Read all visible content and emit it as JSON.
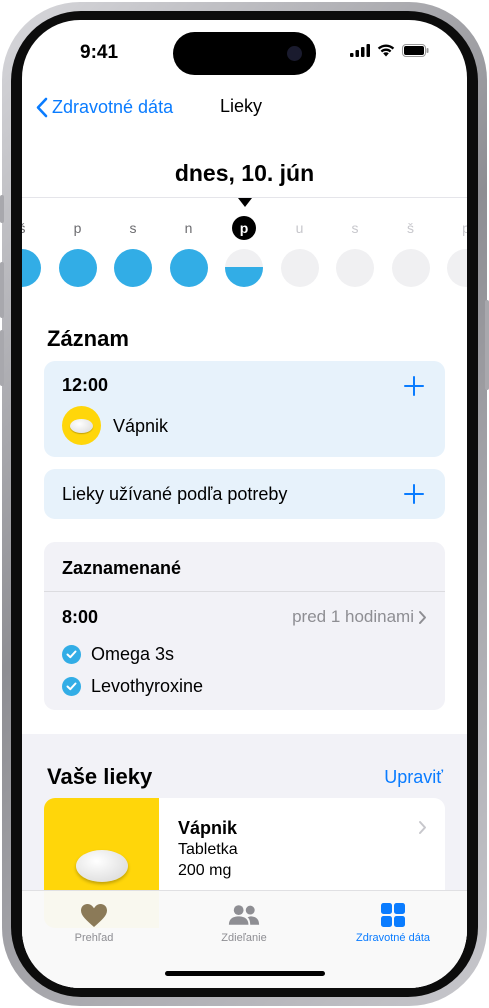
{
  "status": {
    "time": "9:41"
  },
  "nav": {
    "back_label": "Zdravotné dáta",
    "title": "Lieky"
  },
  "date_header": "dnes, 10. jún",
  "week_days": [
    {
      "letter": "š",
      "state": "done",
      "label_style": "normal"
    },
    {
      "letter": "p",
      "state": "done",
      "label_style": "normal"
    },
    {
      "letter": "s",
      "state": "done",
      "label_style": "normal"
    },
    {
      "letter": "n",
      "state": "done",
      "label_style": "normal"
    },
    {
      "letter": "p",
      "state": "half",
      "label_style": "today"
    },
    {
      "letter": "u",
      "state": "empty",
      "label_style": "faded"
    },
    {
      "letter": "s",
      "state": "empty",
      "label_style": "faded"
    },
    {
      "letter": "š",
      "state": "empty",
      "label_style": "faded"
    },
    {
      "letter": "p",
      "state": "empty",
      "label_style": "faded"
    }
  ],
  "log": {
    "title": "Záznam",
    "scheduled": {
      "time": "12:00",
      "medication": "Vápnik"
    },
    "as_needed_label": "Lieky užívané podľa potreby"
  },
  "logged": {
    "title": "Zaznamenané",
    "time": "8:00",
    "ago": "pred 1 hodinami",
    "items": [
      "Omega 3s",
      "Levothyroxine"
    ]
  },
  "your_meds": {
    "title": "Vaše lieky",
    "edit_label": "Upraviť",
    "card": {
      "name": "Vápnik",
      "form": "Tabletka",
      "dose": "200 mg"
    }
  },
  "tabs": [
    {
      "label": "Prehľad",
      "icon": "heart-icon",
      "active": false
    },
    {
      "label": "Zdieľanie",
      "icon": "people-icon",
      "active": false
    },
    {
      "label": "Zdravotné dáta",
      "icon": "grid-icon",
      "active": true
    }
  ],
  "colors": {
    "accent": "#0a7cff",
    "taken": "#32ade6",
    "pill_bg": "#ffd60a",
    "log_card": "#e7f2fb"
  }
}
